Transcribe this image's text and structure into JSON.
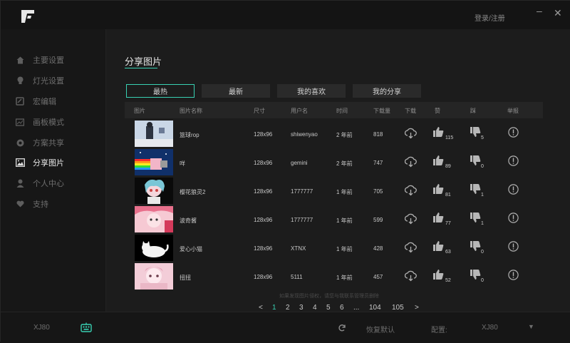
{
  "header": {
    "login_label": "登录/注册"
  },
  "sidebar": {
    "items": [
      {
        "label": "主要设置",
        "icon": "home-icon"
      },
      {
        "label": "灯光设置",
        "icon": "lightbulb-icon"
      },
      {
        "label": "宏编辑",
        "icon": "macro-icon"
      },
      {
        "label": "画板模式",
        "icon": "drawing-board-icon"
      },
      {
        "label": "方案共享",
        "icon": "share-scheme-icon"
      },
      {
        "label": "分享图片",
        "icon": "image-icon",
        "active": true
      },
      {
        "label": "个人中心",
        "icon": "person-icon"
      },
      {
        "label": "支持",
        "icon": "heart-icon"
      }
    ]
  },
  "main": {
    "title": "分享图片",
    "tabs": [
      "最热",
      "最新",
      "我的喜欢",
      "我的分享"
    ],
    "columns": [
      "图片",
      "图片名称",
      "尺寸",
      "用户名",
      "时间",
      "下载量",
      "下载",
      "赞",
      "踩",
      "举报"
    ],
    "rows": [
      {
        "name": "篮球rop",
        "size": "128x96",
        "user": "shiwenyao",
        "time": "2 年前",
        "downloads": "818",
        "likes": "115",
        "dislikes": "5"
      },
      {
        "name": "咩",
        "size": "128x96",
        "user": "gemini",
        "time": "2 年前",
        "downloads": "747",
        "likes": "89",
        "dislikes": "0"
      },
      {
        "name": "樱花狼灵2",
        "size": "128x96",
        "user": "1777777",
        "time": "1 年前",
        "downloads": "705",
        "likes": "81",
        "dislikes": "1"
      },
      {
        "name": "波奇酱",
        "size": "128x96",
        "user": "1777777",
        "time": "1 年前",
        "downloads": "599",
        "likes": "77",
        "dislikes": "1"
      },
      {
        "name": "爱心小猫",
        "size": "128x96",
        "user": "XTNX",
        "time": "1 年前",
        "downloads": "428",
        "likes": "63",
        "dislikes": "0"
      },
      {
        "name": "扭扭",
        "size": "128x96",
        "user": "5111",
        "time": "1 年前",
        "downloads": "457",
        "likes": "52",
        "dislikes": "0"
      }
    ],
    "notice": "如果发现图片侵权，请您与我联系管理员删除",
    "pagination": {
      "prev": "<",
      "pages": [
        "1",
        "2",
        "3",
        "4",
        "5",
        "6",
        "...",
        "104",
        "105"
      ],
      "next": ">",
      "current": "1"
    }
  },
  "footer": {
    "device_name": "XJ80",
    "restore_label": "恢复默认",
    "config_label": "配置:",
    "config_value": "XJ80"
  },
  "colors": {
    "accent": "#38d1b3",
    "background": "#1c1c1c"
  }
}
